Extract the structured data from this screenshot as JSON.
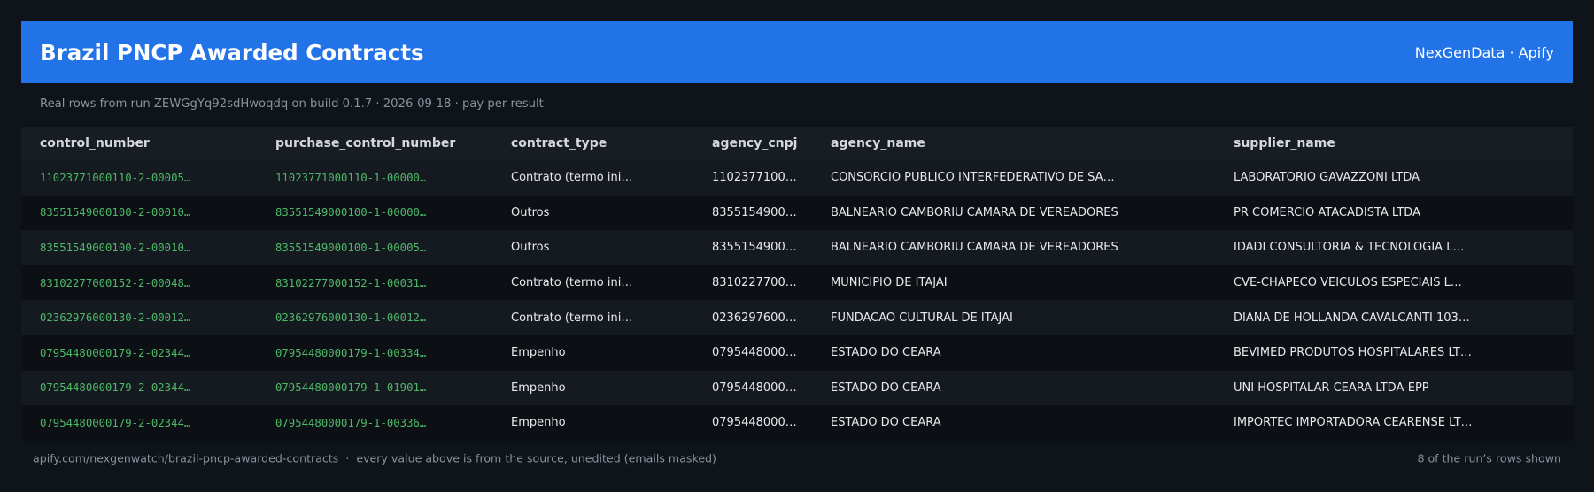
{
  "header": {
    "title": "Brazil PNCP Awarded Contracts",
    "brand": "NexGenData · Apify"
  },
  "subtitle": "Real rows from run ZEWGgYq92sdHwoqdq on build 0.1.7 · 2026-09-18 · pay per result",
  "table": {
    "columns": [
      "control_number",
      "purchase_control_number",
      "contract_type",
      "agency_cnpj",
      "agency_name",
      "supplier_name"
    ],
    "rows": [
      [
        "11023771000110-2-00005…",
        "11023771000110-1-00000…",
        "Contrato (termo ini…",
        "1102377100…",
        "CONSORCIO PUBLICO INTERFEDERATIVO DE SA…",
        "LABORATORIO GAVAZZONI LTDA"
      ],
      [
        "83551549000100-2-00010…",
        "83551549000100-1-00000…",
        "Outros",
        "8355154900…",
        "BALNEARIO CAMBORIU CAMARA DE VEREADORES",
        "PR COMERCIO ATACADISTA LTDA"
      ],
      [
        "83551549000100-2-00010…",
        "83551549000100-1-00005…",
        "Outros",
        "8355154900…",
        "BALNEARIO CAMBORIU CAMARA DE VEREADORES",
        "IDADI CONSULTORIA & TECNOLOGIA L…"
      ],
      [
        "83102277000152-2-00048…",
        "83102277000152-1-00031…",
        "Contrato (termo ini…",
        "8310227700…",
        "MUNICIPIO DE ITAJAI",
        "CVE-CHAPECO VEICULOS ESPECIAIS L…"
      ],
      [
        "02362976000130-2-00012…",
        "02362976000130-1-00012…",
        "Contrato (termo ini…",
        "0236297600…",
        "FUNDACAO CULTURAL DE ITAJAI",
        "DIANA DE HOLLANDA CAVALCANTI 103…"
      ],
      [
        "07954480000179-2-02344…",
        "07954480000179-1-00334…",
        "Empenho",
        "0795448000…",
        "ESTADO DO CEARA",
        "BEVIMED PRODUTOS HOSPITALARES LT…"
      ],
      [
        "07954480000179-2-02344…",
        "07954480000179-1-01901…",
        "Empenho",
        "0795448000…",
        "ESTADO DO CEARA",
        "UNI HOSPITALAR CEARA LTDA-EPP"
      ],
      [
        "07954480000179-2-02344…",
        "07954480000179-1-00336…",
        "Empenho",
        "0795448000…",
        "ESTADO DO CEARA",
        "IMPORTEC IMPORTADORA CEARENSE LT…"
      ]
    ]
  },
  "footer": {
    "left": "apify.com/nexgenwatch/brazil-pncp-awarded-contracts  ·  every value above is from the source, unedited (emails masked)",
    "right": "8 of the run’s rows shown"
  },
  "colors": {
    "header_bg": "#2272e8",
    "page_bg": "#0f131a",
    "id_text": "#4fb868",
    "muted_text": "#8b929c"
  }
}
